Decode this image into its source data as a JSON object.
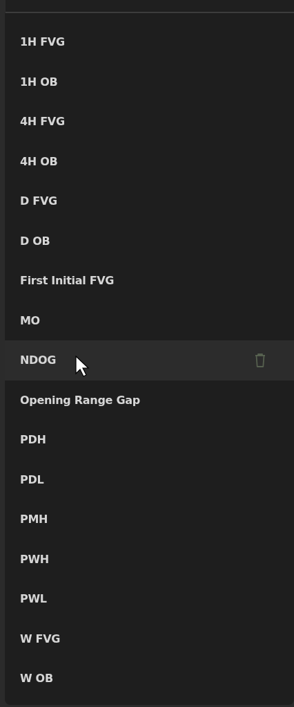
{
  "menu": {
    "items": [
      {
        "label": "1H FVG",
        "hovered": false
      },
      {
        "label": "1H OB",
        "hovered": false
      },
      {
        "label": "4H FVG",
        "hovered": false
      },
      {
        "label": "4H OB",
        "hovered": false
      },
      {
        "label": "D FVG",
        "hovered": false
      },
      {
        "label": "D OB",
        "hovered": false
      },
      {
        "label": "First Initial FVG",
        "hovered": false
      },
      {
        "label": "MO",
        "hovered": false
      },
      {
        "label": "NDOG",
        "hovered": true
      },
      {
        "label": "Opening Range Gap",
        "hovered": false
      },
      {
        "label": "PDH",
        "hovered": false
      },
      {
        "label": "PDL",
        "hovered": false
      },
      {
        "label": "PMH",
        "hovered": false
      },
      {
        "label": "PWH",
        "hovered": false
      },
      {
        "label": "PWL",
        "hovered": false
      },
      {
        "label": "W FVG",
        "hovered": false
      },
      {
        "label": "W OB",
        "hovered": false
      }
    ]
  }
}
